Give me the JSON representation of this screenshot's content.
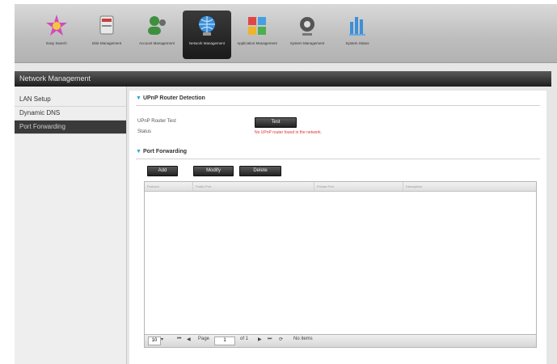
{
  "toolbar": {
    "items": [
      {
        "label": "Easy Search",
        "icon": "wizard-icon"
      },
      {
        "label": "Disk Management",
        "icon": "disk-icon"
      },
      {
        "label": "Account Management",
        "icon": "account-icon"
      },
      {
        "label": "Network Management",
        "icon": "network-icon"
      },
      {
        "label": "Application Management",
        "icon": "application-icon"
      },
      {
        "label": "System Management",
        "icon": "system-icon"
      },
      {
        "label": "System Status",
        "icon": "status-icon"
      }
    ],
    "active_index": 3
  },
  "header": {
    "title": "Network Management"
  },
  "sidebar": {
    "items": [
      {
        "label": "LAN Setup"
      },
      {
        "label": "Dynamic DNS"
      },
      {
        "label": "Port Forwarding"
      }
    ],
    "active_index": 2
  },
  "upnp": {
    "title": "UPnP Router Detection",
    "router_test_label": "UPnP Router Test",
    "test_button": "Test",
    "status_label": "Status",
    "status_value": "No UPnP router found in the network."
  },
  "port_forwarding": {
    "title": "Port Forwarding",
    "add_button": "Add",
    "modify_button": "Modify",
    "delete_button": "Delete",
    "columns": [
      "Protocol",
      "Public Port",
      "Private Port",
      "Description"
    ]
  },
  "pager": {
    "rows_per_page": "10",
    "page_label": "Page",
    "page_value": "1",
    "of_total": "of 1",
    "no_items": "No items"
  },
  "colors": {
    "accent": "#2aa6d6",
    "status_error": "#e03030",
    "active_bg": "#1a1a1a"
  }
}
